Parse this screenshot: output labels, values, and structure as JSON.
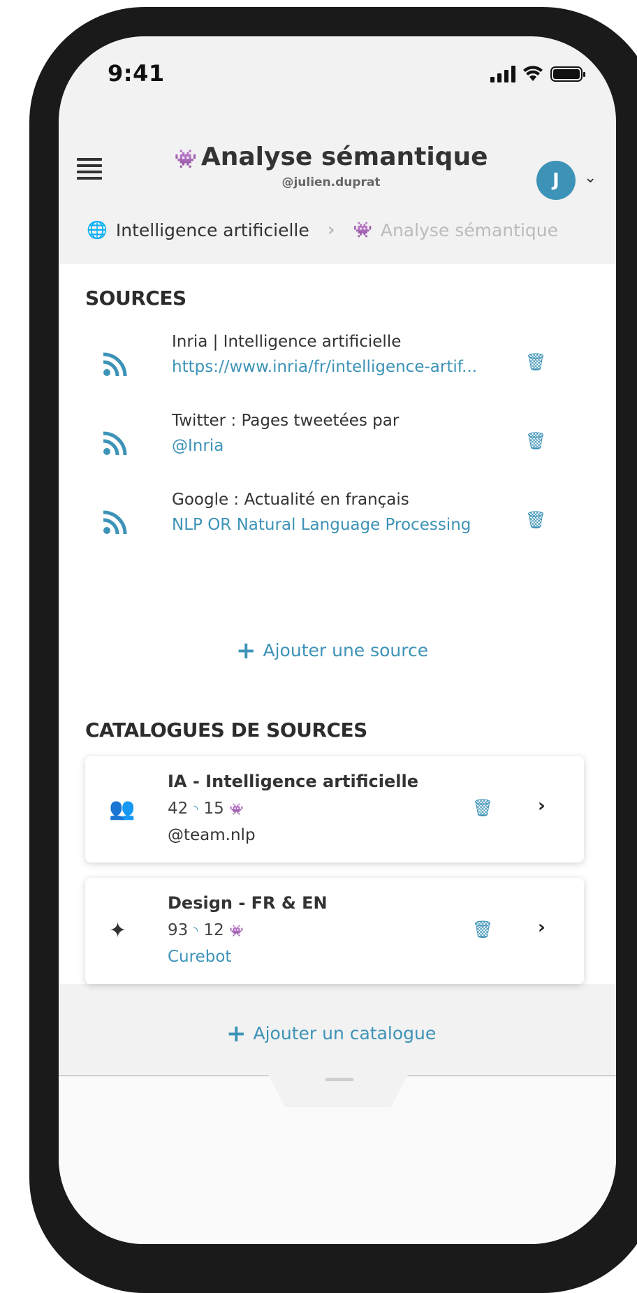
{
  "status_bar": {
    "time": "9:41"
  },
  "header": {
    "title": "Analyse sémantique",
    "title_icon": "bug-icon",
    "subtitle": "@julien.duprat",
    "avatar_initial": "J"
  },
  "breadcrumb": {
    "root": "Intelligence artificielle",
    "current": "Analyse sémantique"
  },
  "sources": {
    "title": "SOURCES",
    "items": [
      {
        "name": "Inria | Intelligence artificielle",
        "link": "https://www.inria/fr/intelligence-artif..."
      },
      {
        "name": "Twitter : Pages tweetées par",
        "link": "@Inria"
      },
      {
        "name": "Google : Actualité en français",
        "link": "NLP OR Natural Language Processing"
      }
    ],
    "add_label": "Ajouter une source"
  },
  "catalogues": {
    "title": "CATALOGUES DE SOURCES",
    "items": [
      {
        "title": "IA - Intelligence artificielle",
        "sources_count": "42",
        "analyses_count": "15",
        "owner": "@team.nlp",
        "owner_color": "#333333",
        "icon": "users-icon"
      },
      {
        "title": "Design - FR & EN",
        "sources_count": "93",
        "analyses_count": "12",
        "owner": "Curebot",
        "owner_color": "#3d93b7",
        "icon": "sparkles-icon"
      }
    ],
    "add_label": "Ajouter un catalogue"
  },
  "colors": {
    "accent": "#3d93b7",
    "text": "#333333",
    "muted": "#bbbbbb"
  }
}
